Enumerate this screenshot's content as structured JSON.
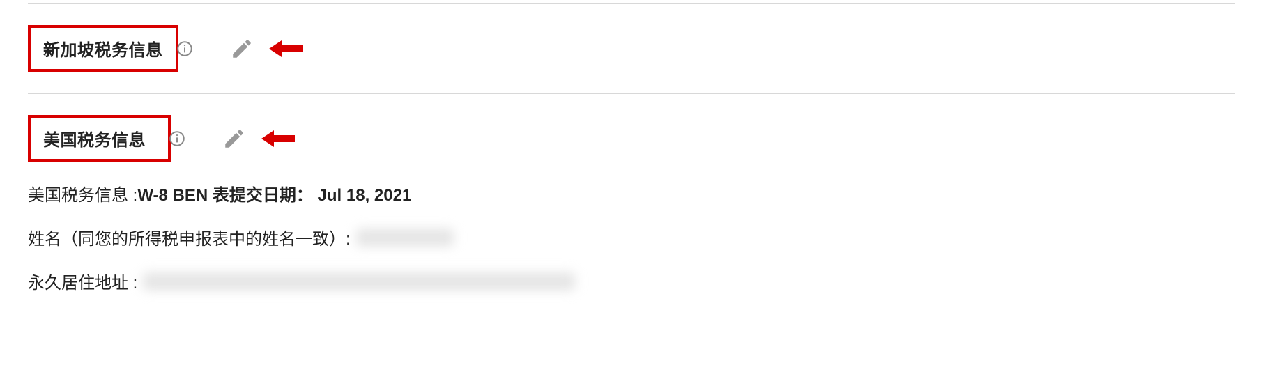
{
  "sections": {
    "singapore": {
      "title": "新加坡税务信息"
    },
    "usa": {
      "title": "美国税务信息",
      "details": {
        "form_label": "美国税务信息 :",
        "form_text": "W-8 BEN 表提交日期： Jul 18, 2021",
        "name_label": "姓名（同您的所得税申报表中的姓名一致）:",
        "address_label": "永久居住地址 :"
      }
    }
  }
}
